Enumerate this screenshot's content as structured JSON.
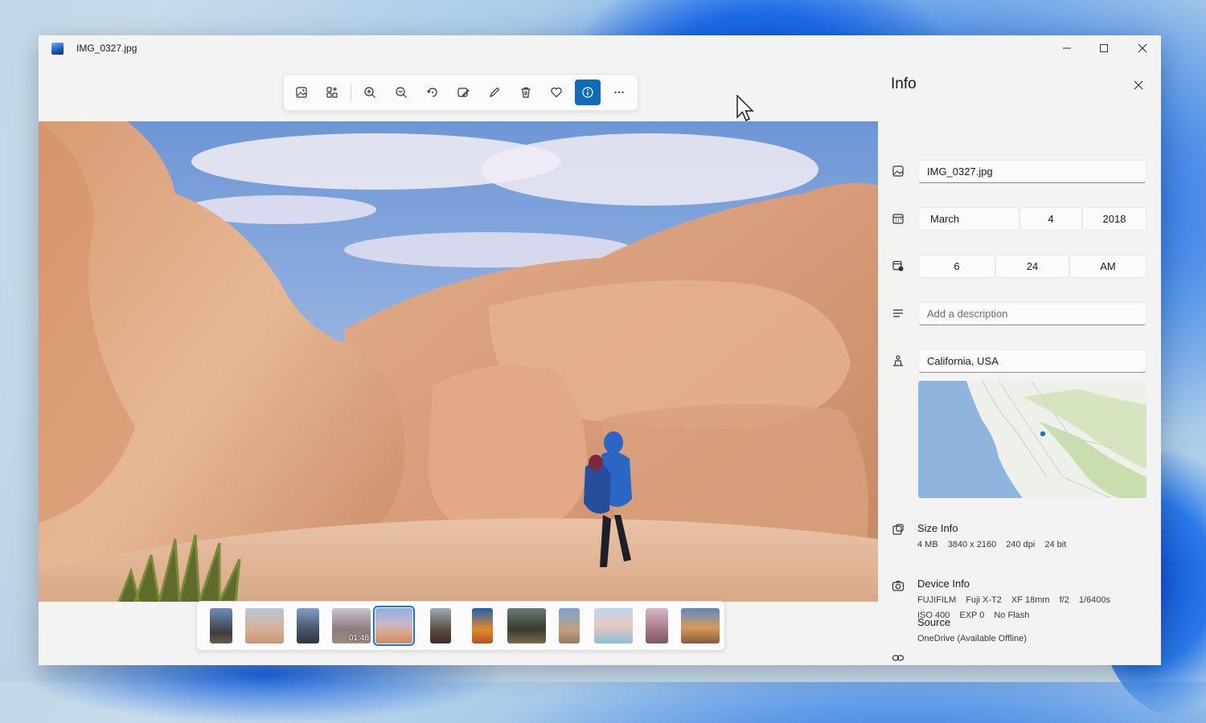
{
  "window": {
    "title": "IMG_0327.jpg"
  },
  "toolbar": {
    "buttons": [
      {
        "name": "see-all-photos-icon"
      },
      {
        "name": "view-collection-icon"
      },
      {
        "name": "zoom-in-icon"
      },
      {
        "name": "zoom-out-icon"
      },
      {
        "name": "rotate-icon"
      },
      {
        "name": "edit-image-icon"
      },
      {
        "name": "draw-icon"
      },
      {
        "name": "delete-icon"
      },
      {
        "name": "favorite-icon"
      },
      {
        "name": "info-icon",
        "active": true
      },
      {
        "name": "more-icon"
      }
    ]
  },
  "filmstrip": {
    "selected_index": 4,
    "video_duration": "01:46"
  },
  "info": {
    "title": "Info",
    "filename": "IMG_0327.jpg",
    "date": {
      "month": "March",
      "day": "4",
      "year": "2018"
    },
    "time": {
      "hour": "6",
      "minute": "24",
      "period": "AM"
    },
    "description_placeholder": "Add a description",
    "location": "California, USA",
    "size_info": {
      "title": "Size Info",
      "file_size": "4 MB",
      "dimensions": "3840 x 2160",
      "dpi": "240 dpi",
      "bit_depth": "24 bit"
    },
    "device_info": {
      "title": "Device Info",
      "make": "FUJIFILM",
      "model": "Fuji X-T2",
      "lens": "XF 18mm",
      "aperture": "f/2",
      "shutter": "1/6400s",
      "iso": "ISO 400",
      "exposure": "EXP 0",
      "flash": "No Flash"
    },
    "source": {
      "title": "Source",
      "value": "OneDrive (Available Offline)"
    }
  },
  "colors": {
    "accent": "#0f6cbd",
    "window_bg": "#f3f3f3"
  }
}
